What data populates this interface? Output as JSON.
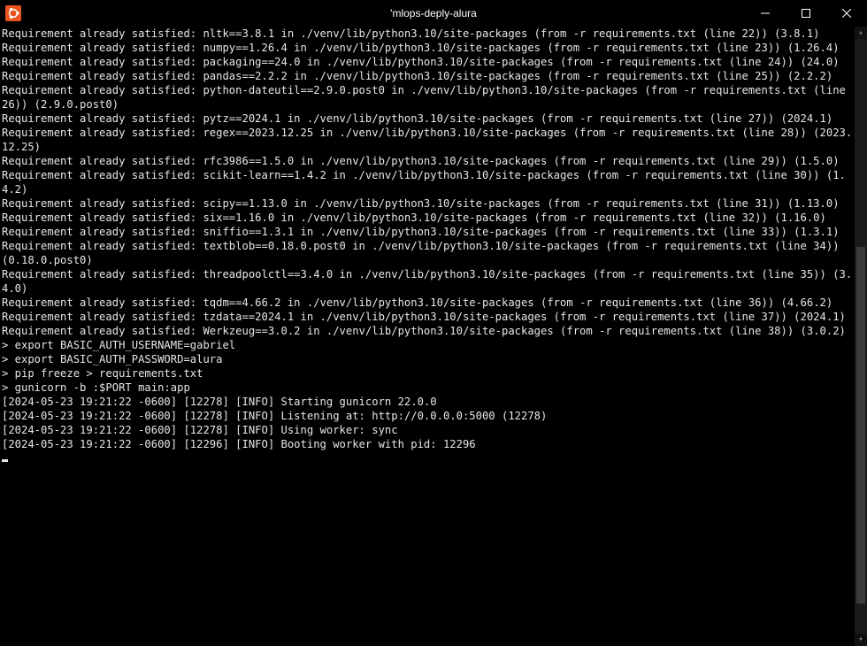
{
  "window": {
    "title": "'mlops-deply-alura"
  },
  "terminal": {
    "lines": [
      "Requirement already satisfied: nltk==3.8.1 in ./venv/lib/python3.10/site-packages (from -r requirements.txt (line 22)) (3.8.1)",
      "Requirement already satisfied: numpy==1.26.4 in ./venv/lib/python3.10/site-packages (from -r requirements.txt (line 23)) (1.26.4)",
      "Requirement already satisfied: packaging==24.0 in ./venv/lib/python3.10/site-packages (from -r requirements.txt (line 24)) (24.0)",
      "Requirement already satisfied: pandas==2.2.2 in ./venv/lib/python3.10/site-packages (from -r requirements.txt (line 25)) (2.2.2)",
      "Requirement already satisfied: python-dateutil==2.9.0.post0 in ./venv/lib/python3.10/site-packages (from -r requirements.txt (line 26)) (2.9.0.post0)",
      "Requirement already satisfied: pytz==2024.1 in ./venv/lib/python3.10/site-packages (from -r requirements.txt (line 27)) (2024.1)",
      "Requirement already satisfied: regex==2023.12.25 in ./venv/lib/python3.10/site-packages (from -r requirements.txt (line 28)) (2023.12.25)",
      "Requirement already satisfied: rfc3986==1.5.0 in ./venv/lib/python3.10/site-packages (from -r requirements.txt (line 29)) (1.5.0)",
      "Requirement already satisfied: scikit-learn==1.4.2 in ./venv/lib/python3.10/site-packages (from -r requirements.txt (line 30)) (1.4.2)",
      "Requirement already satisfied: scipy==1.13.0 in ./venv/lib/python3.10/site-packages (from -r requirements.txt (line 31)) (1.13.0)",
      "Requirement already satisfied: six==1.16.0 in ./venv/lib/python3.10/site-packages (from -r requirements.txt (line 32)) (1.16.0)",
      "Requirement already satisfied: sniffio==1.3.1 in ./venv/lib/python3.10/site-packages (from -r requirements.txt (line 33)) (1.3.1)",
      "Requirement already satisfied: textblob==0.18.0.post0 in ./venv/lib/python3.10/site-packages (from -r requirements.txt (line 34)) (0.18.0.post0)",
      "Requirement already satisfied: threadpoolctl==3.4.0 in ./venv/lib/python3.10/site-packages (from -r requirements.txt (line 35)) (3.4.0)",
      "Requirement already satisfied: tqdm==4.66.2 in ./venv/lib/python3.10/site-packages (from -r requirements.txt (line 36)) (4.66.2)",
      "Requirement already satisfied: tzdata==2024.1 in ./venv/lib/python3.10/site-packages (from -r requirements.txt (line 37)) (2024.1)",
      "Requirement already satisfied: Werkzeug==3.0.2 in ./venv/lib/python3.10/site-packages (from -r requirements.txt (line 38)) (3.0.2)",
      "> export BASIC_AUTH_USERNAME=gabriel",
      "> export BASIC_AUTH_PASSWORD=alura",
      "> pip freeze > requirements.txt",
      "> gunicorn -b :$PORT main:app",
      "[2024-05-23 19:21:22 -0600] [12278] [INFO] Starting gunicorn 22.0.0",
      "[2024-05-23 19:21:22 -0600] [12278] [INFO] Listening at: http://0.0.0.0:5000 (12278)",
      "[2024-05-23 19:21:22 -0600] [12278] [INFO] Using worker: sync",
      "[2024-05-23 19:21:22 -0600] [12296] [INFO] Booting worker with pid: 12296"
    ]
  },
  "scroll": {
    "up_glyph": "▴",
    "down_glyph": "▾"
  }
}
